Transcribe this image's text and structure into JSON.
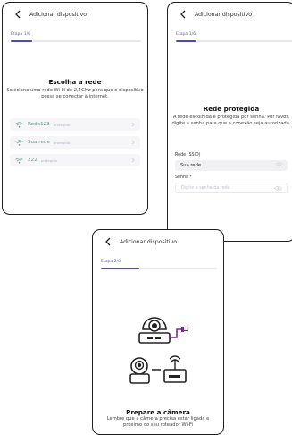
{
  "colors": {
    "accent": "#4b4bab",
    "wifi_green": "#5d9a7e",
    "camera_purple": "#7a2a8a",
    "track": "#e6e6f0"
  },
  "screen1": {
    "header_title": "Adicionar dispositivo",
    "step_label": "Etapa 1/6",
    "progress": 0.166,
    "title": "Escolha a rede",
    "subtitle": "Selecione uma rede Wi-Fi de 2,4GHz para que o dispositivo possa se conectar à internet.",
    "networks": [
      {
        "name": "Rede123",
        "tag": "protegida",
        "icon": "wifi-icon"
      },
      {
        "name": "Sua rede",
        "tag": "protegida",
        "icon": "wifi-icon"
      },
      {
        "name": "222",
        "tag": "protegida",
        "icon": "wifi-icon"
      }
    ]
  },
  "screen2": {
    "header_title": "Adicionar dispositivo",
    "step_label": "Etapa 1/6",
    "progress": 0.166,
    "title": "Rede protegida",
    "subtitle": "A rede escolhida é protegida por senha. Por favor, digite a senha para que a conexão seja autorizada.",
    "ssid_label": "Rede (SSID)",
    "ssid_value": "Sua rede",
    "password_label": "Senha *",
    "password_placeholder": "Digite a senha da rede"
  },
  "screen3": {
    "header_title": "Adicionar dispositivo",
    "step_label": "Etapa 2/6",
    "progress": 0.333,
    "title": "Prepare a câmera",
    "subtitle": "Lembre que a câmera precisa estar ligada e próximo do seu roteador Wi-Fi"
  }
}
